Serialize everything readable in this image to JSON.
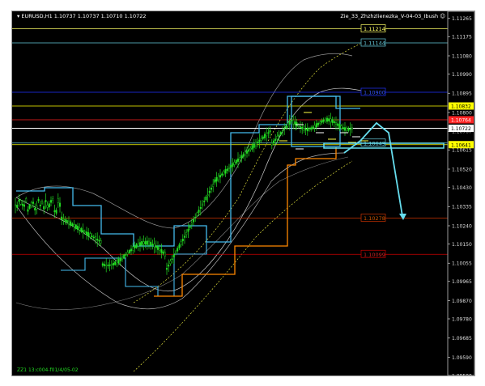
{
  "header": {
    "symbol_info": "EURUSD,H1  1.10737 1.10737 1.10710 1.10722",
    "indicator": "Zie_33_Zhzhzlienezka_V-04-03_Ibush"
  },
  "footer": {
    "label": "ZZ1 13:c004-f01/4/05-02"
  },
  "price_axis": {
    "min": 1.095,
    "max": 1.113,
    "ticks": [
      "1.11265",
      "1.11175",
      "1.11080",
      "1.10990",
      "1.10895",
      "1.10800",
      "1.10707",
      "1.10615",
      "1.10520",
      "1.10430",
      "1.10335",
      "1.10240",
      "1.10150",
      "1.10055",
      "1.09965",
      "1.09870",
      "1.09780",
      "1.09685",
      "1.09590",
      "1.09500"
    ]
  },
  "levels": [
    {
      "label": "1.11214",
      "color": "#ffff66",
      "label_color": "#ffff66"
    },
    {
      "label": "1.11144",
      "color": "#66ccdd",
      "label_color": "#66ccdd"
    },
    {
      "label": "1.10900",
      "color": "#2233ff",
      "label_color": "#3355ff"
    },
    {
      "label": "1.10832",
      "color": "#ffff00",
      "label_color": "#ffff00",
      "tag": true
    },
    {
      "label": "1.10764",
      "color": "#ff2222",
      "label_color": "#ff2222",
      "tag": true
    },
    {
      "label": "1.10722",
      "color": "#ffffff",
      "label_color": "#ffffff",
      "tag": true
    },
    {
      "label": "1.10641",
      "color": "#ffff00",
      "label_color": "#ffff00",
      "tag": true
    },
    {
      "label": "1.10649",
      "color": "#66ccdd",
      "label_color": "#66ccdd"
    },
    {
      "label": "1.10278",
      "color": "#cc3300",
      "label_color": "#cc5500"
    },
    {
      "label": "1.10099",
      "color": "#cc0000",
      "label_color": "#cc2222"
    }
  ],
  "colors": {
    "background": "#000000",
    "candles": "#22dd22",
    "channel_cyan": "#44bbee",
    "channel_orange": "#ff8800",
    "envelope": "#ffffff",
    "dashed": "#ffff44",
    "forecast": "#66ddee"
  }
}
